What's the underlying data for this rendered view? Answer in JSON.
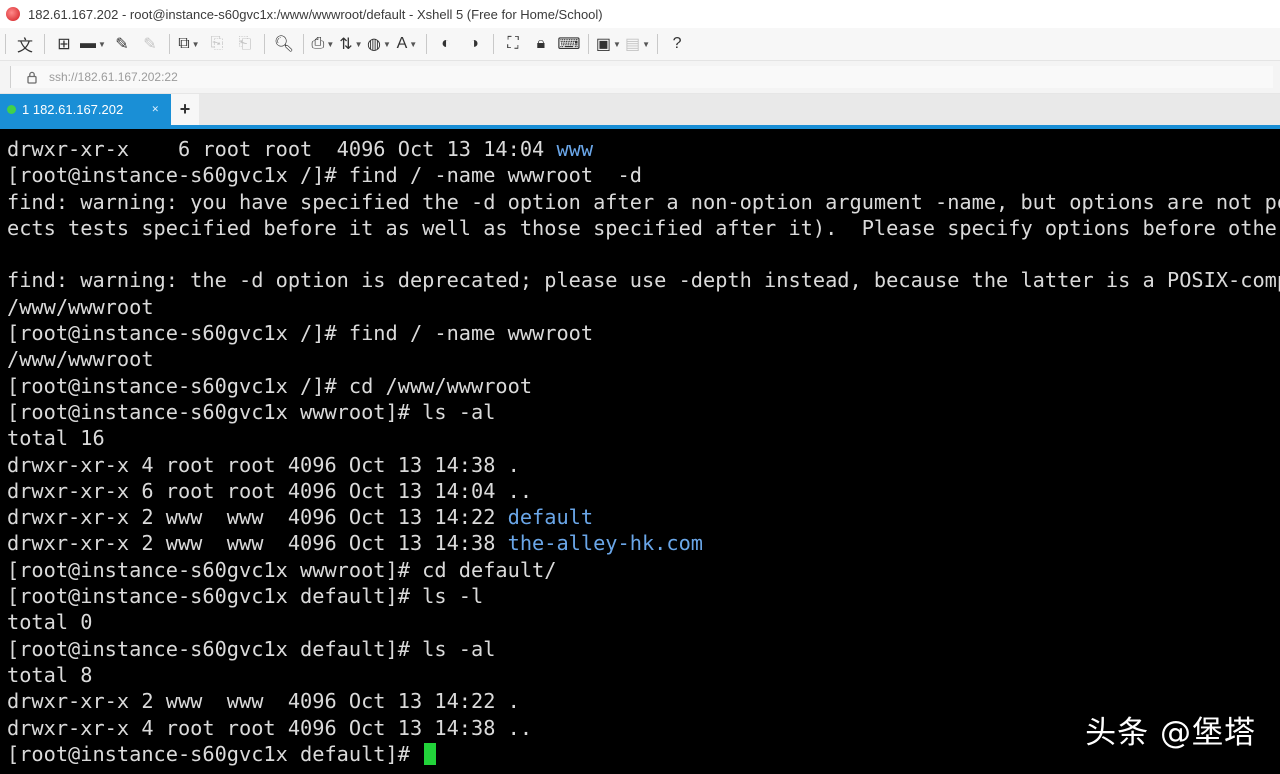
{
  "window": {
    "title": "182.61.167.202 - root@instance-s60gvc1x:/www/wwwroot/default - Xshell 5 (Free for Home/School)"
  },
  "toolbar": {
    "buttons": [
      {
        "name": "text-icon",
        "glyph": "文",
        "dim": false,
        "dropdown": false
      },
      {
        "name": "new-session-icon",
        "glyph": "⊞",
        "dim": false,
        "dropdown": false
      },
      {
        "name": "folder-open-icon",
        "glyph": "▬",
        "dim": false,
        "dropdown": true
      },
      {
        "name": "connect-icon",
        "glyph": "✎",
        "dim": false,
        "dropdown": false
      },
      {
        "name": "disconnect-icon",
        "glyph": "✎",
        "dim": true,
        "dropdown": false
      },
      {
        "name": "properties-icon",
        "glyph": "⧉",
        "dim": false,
        "dropdown": true
      },
      {
        "name": "copy-icon",
        "glyph": "⎘",
        "dim": true,
        "dropdown": false
      },
      {
        "name": "paste-icon",
        "glyph": "⎗",
        "dim": true,
        "dropdown": false
      },
      {
        "name": "find-icon",
        "glyph": "🔍︎",
        "dim": false,
        "dropdown": false
      },
      {
        "name": "print-icon",
        "glyph": "⎙",
        "dim": false,
        "dropdown": true
      },
      {
        "name": "transfer-icon",
        "glyph": "⇅",
        "dim": false,
        "dropdown": true
      },
      {
        "name": "globe-icon",
        "glyph": "◍",
        "dim": false,
        "dropdown": true
      },
      {
        "name": "font-icon",
        "glyph": "A",
        "dim": false,
        "dropdown": true
      },
      {
        "name": "xftp-icon",
        "glyph": "◐",
        "dim": false,
        "dropdown": false
      },
      {
        "name": "xmanager-icon",
        "glyph": "◑",
        "dim": false,
        "dropdown": false
      },
      {
        "name": "fullscreen-icon",
        "glyph": "⛶",
        "dim": false,
        "dropdown": false
      },
      {
        "name": "lock-icon",
        "glyph": "🔒︎",
        "dim": false,
        "dropdown": false
      },
      {
        "name": "keyboard-icon",
        "glyph": "⌨",
        "dim": false,
        "dropdown": false
      },
      {
        "name": "script-icon",
        "glyph": "▣",
        "dim": false,
        "dropdown": true
      },
      {
        "name": "layout-icon",
        "glyph": "▤",
        "dim": true,
        "dropdown": true
      },
      {
        "name": "help-icon",
        "glyph": "?",
        "dim": false,
        "dropdown": false
      }
    ]
  },
  "address": {
    "url": "ssh://182.61.167.202:22"
  },
  "tabs": [
    {
      "label": "1 182.61.167.202",
      "close": "✕"
    }
  ],
  "new_tab_glyph": "+",
  "terminal": {
    "lines": [
      [
        {
          "t": "drwxr-xr-x    6 root root  4096 Oct 13 14:04 "
        },
        {
          "t": "www",
          "c": "blue"
        }
      ],
      [
        {
          "t": "[root@instance-s60gvc1x /]# find / -name wwwroot  -d"
        }
      ],
      [
        {
          "t": "find: warning: you have specified the -d option after a non-option argument -name, but options are not positional (-d aff"
        }
      ],
      [
        {
          "t": "ects tests specified before it as well as those specified after it).  Please specify options before other arguments."
        }
      ],
      [
        {
          "t": ""
        }
      ],
      [
        {
          "t": "find: warning: the -d option is deprecated; please use -depth instead, because the latter is a POSIX-compliant feature."
        }
      ],
      [
        {
          "t": "/www/wwwroot"
        }
      ],
      [
        {
          "t": "[root@instance-s60gvc1x /]# find / -name wwwroot"
        }
      ],
      [
        {
          "t": "/www/wwwroot"
        }
      ],
      [
        {
          "t": "[root@instance-s60gvc1x /]# cd /www/wwwroot"
        }
      ],
      [
        {
          "t": "[root@instance-s60gvc1x wwwroot]# ls -al"
        }
      ],
      [
        {
          "t": "total 16"
        }
      ],
      [
        {
          "t": "drwxr-xr-x 4 root root 4096 Oct 13 14:38 ."
        }
      ],
      [
        {
          "t": "drwxr-xr-x 6 root root 4096 Oct 13 14:04 .."
        }
      ],
      [
        {
          "t": "drwxr-xr-x 2 www  www  4096 Oct 13 14:22 "
        },
        {
          "t": "default",
          "c": "blue"
        }
      ],
      [
        {
          "t": "drwxr-xr-x 2 www  www  4096 Oct 13 14:38 "
        },
        {
          "t": "the-alley-hk.com",
          "c": "blue"
        }
      ],
      [
        {
          "t": "[root@instance-s60gvc1x wwwroot]# cd default/"
        }
      ],
      [
        {
          "t": "[root@instance-s60gvc1x default]# ls -l"
        }
      ],
      [
        {
          "t": "total 0"
        }
      ],
      [
        {
          "t": "[root@instance-s60gvc1x default]# ls -al"
        }
      ],
      [
        {
          "t": "total 8"
        }
      ],
      [
        {
          "t": "drwxr-xr-x 2 www  www  4096 Oct 13 14:22 ."
        }
      ],
      [
        {
          "t": "drwxr-xr-x 4 root root 4096 Oct 13 14:38 .."
        }
      ],
      [
        {
          "t": "[root@instance-s60gvc1x default]# "
        }
      ]
    ],
    "cursor_line": 23
  },
  "watermark": "头条 @堡塔"
}
